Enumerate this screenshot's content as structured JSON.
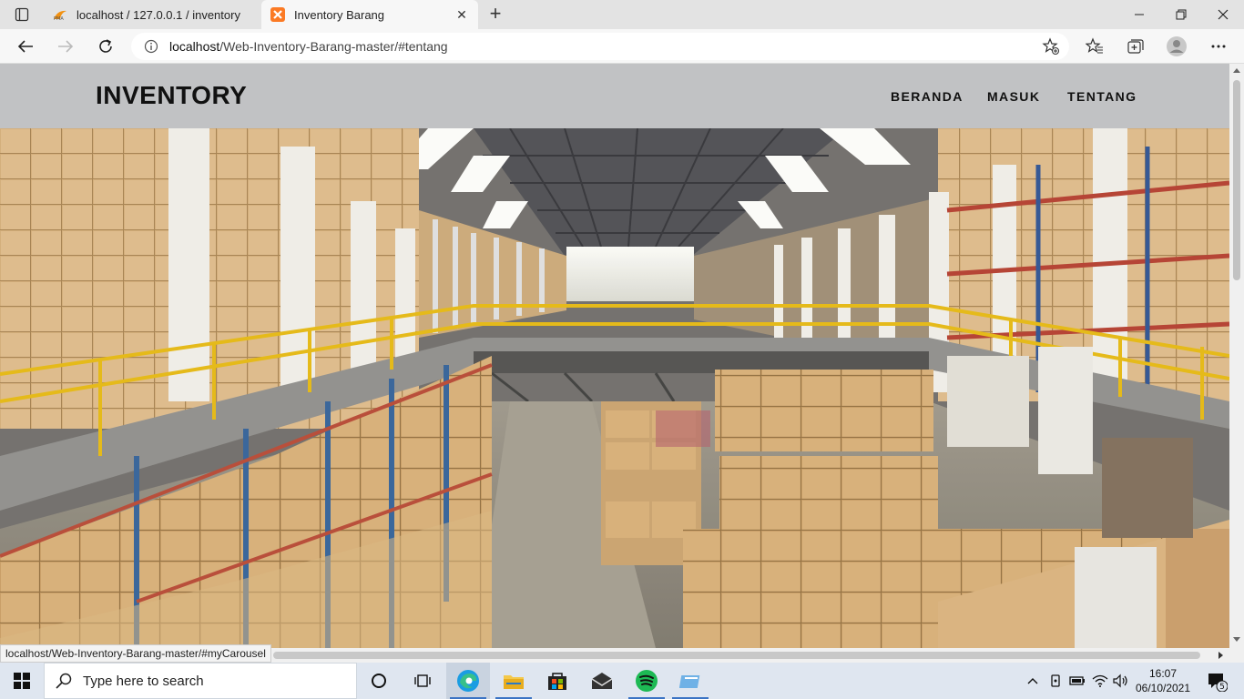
{
  "browser": {
    "tabs": [
      {
        "title": "localhost / 127.0.0.1 / inventory",
        "favicon": "phpmyadmin-icon"
      },
      {
        "title": "Inventory Barang",
        "favicon": "xampp-icon"
      }
    ],
    "address": {
      "host": "localhost",
      "path": "/Web-Inventory-Barang-master/#tentang"
    }
  },
  "page": {
    "brand": "INVENTORY",
    "nav": {
      "home": "BERANDA",
      "login": "MASUK",
      "about": "TENTANG"
    },
    "carousel": {
      "slides": 3,
      "active_index": 1,
      "scene": "warehouse-interior-photo"
    }
  },
  "status_url": "localhost/Web-Inventory-Barang-master/#myCarousel",
  "taskbar": {
    "search_placeholder": "Type here to search",
    "time": "16:07",
    "date": "06/10/2021",
    "notifications": "5"
  },
  "colors": {
    "navbar_bg": "#c1c2c4",
    "taskbar_bg": "#dfe6f0"
  }
}
